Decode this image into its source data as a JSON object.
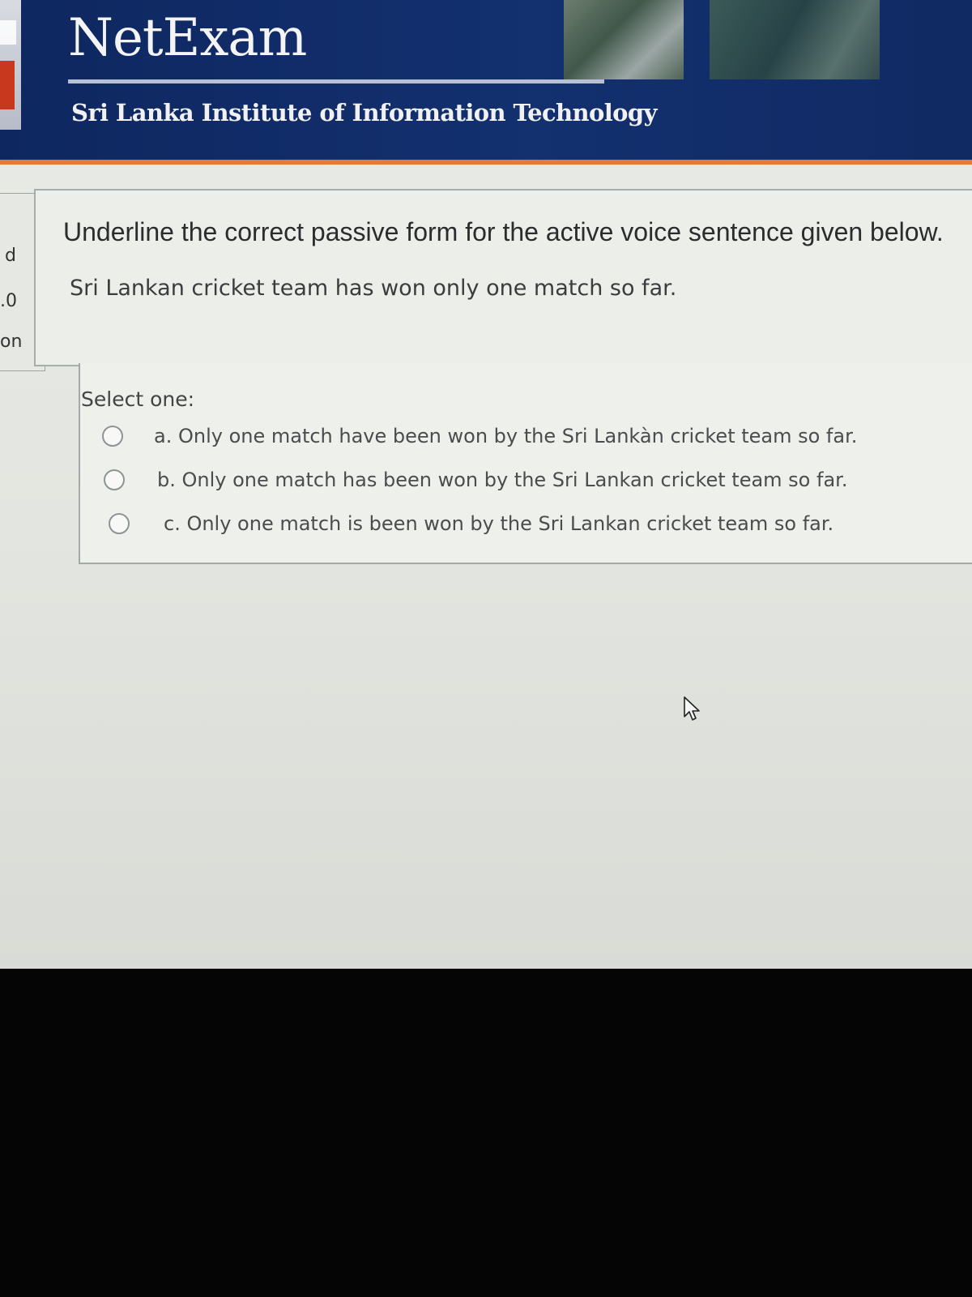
{
  "header": {
    "brand": "NetExam",
    "institute": "Sri Lanka Institute of Information Technology"
  },
  "side_panel": {
    "fragments": [
      "d",
      ".0",
      "on"
    ]
  },
  "question": {
    "instruction": "Underline the correct passive form for the active voice sentence given below.",
    "sentence": "Sri Lankan cricket team has won only one match so far."
  },
  "answer": {
    "select_label": "Select one:",
    "options": [
      {
        "label": "a. Only one match have been won by the Sri Lankàn cricket team so far.",
        "selected": false
      },
      {
        "label": "b. Only one match has been won by the Sri Lankan cricket team so far.",
        "selected": false
      },
      {
        "label": "c. Only one match is been won by the Sri Lankan cricket team so far.",
        "selected": false
      }
    ]
  },
  "colors": {
    "header_bg": "#13306f",
    "header_accent": "#e07a3e",
    "page_bg": "#e9ebe6"
  },
  "icons": {
    "cursor": "mouse-pointer-icon",
    "logo": "sliit-logo-icon"
  }
}
